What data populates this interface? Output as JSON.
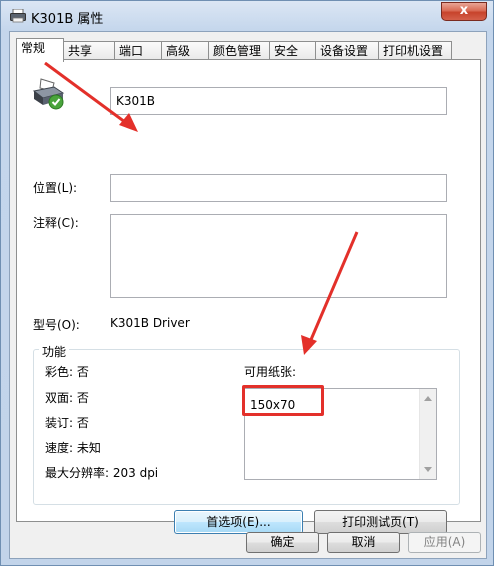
{
  "window": {
    "title": "K301B 属性",
    "close_label": "x"
  },
  "tabs": [
    {
      "label": "常规"
    },
    {
      "label": "共享"
    },
    {
      "label": "端口"
    },
    {
      "label": "高级"
    },
    {
      "label": "颜色管理"
    },
    {
      "label": "安全"
    },
    {
      "label": "设备设置"
    },
    {
      "label": "打印机设置"
    }
  ],
  "general": {
    "printer_name": "K301B",
    "location_label": "位置(L):",
    "location_value": "",
    "comment_label": "注释(C):",
    "comment_value": "",
    "model_label": "型号(O):",
    "model_value": "K301B Driver"
  },
  "features": {
    "title": "功能",
    "color": "彩色: 否",
    "duplex": "双面: 否",
    "staple": "装订: 否",
    "speed": "速度: 未知",
    "max_resolution": "最大分辨率: 203 dpi",
    "paper_label": "可用纸张:",
    "paper_items": [
      "150x70"
    ]
  },
  "buttons": {
    "preferences": "首选项(E)...",
    "print_test": "打印测试页(T)",
    "ok": "确定",
    "cancel": "取消",
    "apply": "应用(A)"
  },
  "colors": {
    "annotation_red": "#e3302a",
    "window_frame": "#c2d4ea",
    "close_red": "#c7432b"
  },
  "icons": {
    "title_icon": "printer-icon",
    "printer_large": "printer-ok-icon"
  }
}
